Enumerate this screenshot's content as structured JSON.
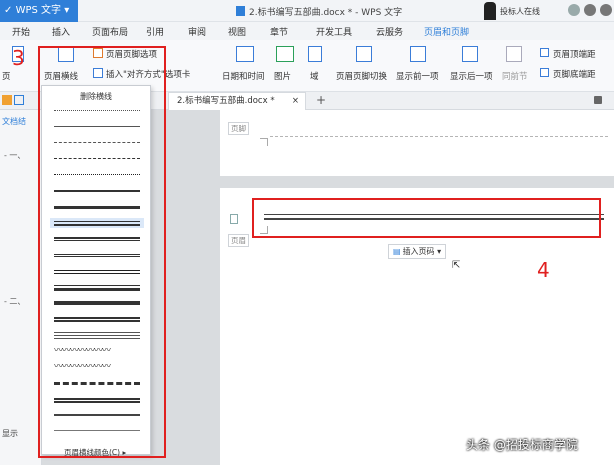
{
  "title_bar": {
    "app_name": "WPS 文字",
    "document_title": "2.标书编写五部曲.docx * - WPS 文字",
    "user_label": "投标人在线"
  },
  "tabs": [
    "开始",
    "插入",
    "页面布局",
    "引用",
    "审阅",
    "视图",
    "章节",
    "开发工具",
    "云服务",
    "页眉和页脚"
  ],
  "active_tab": "页眉和页脚",
  "ribbon": {
    "page_header_options": "页眉页脚选项",
    "header_line": "页眉横线",
    "insert_align_tab": "插入\"对齐方式\"选项卡",
    "page": "页",
    "date_time": "日期和时间",
    "picture": "图片",
    "field": "域",
    "switch_header_footer": "页眉页脚切换",
    "show_prev": "显示前一项",
    "show_next": "显示后一项",
    "same_as_prev": "同前节",
    "header_top_distance": "页眉顶端距",
    "footer_bottom_distance": "页脚底端距"
  },
  "doc_tab": {
    "name": "2.标书编写五部曲.docx *",
    "close": "×",
    "new_tab": "+"
  },
  "nav_pane": {
    "label": "文档结",
    "row1": "- 一、",
    "row2": "- 二、",
    "show": "显示"
  },
  "dropdown": {
    "title": "删除横线",
    "footer": "页眉横线颜色(C) ▸"
  },
  "document": {
    "footer_label": "页脚",
    "header_label": "页眉",
    "insert_page_number": "插入页码 ▾"
  },
  "annotations": {
    "step3": "3",
    "step4": "4"
  },
  "watermark": "头条 @招投标商学院",
  "colors": {
    "accent": "#2f7fd8",
    "annotation_red": "#e0201f"
  }
}
